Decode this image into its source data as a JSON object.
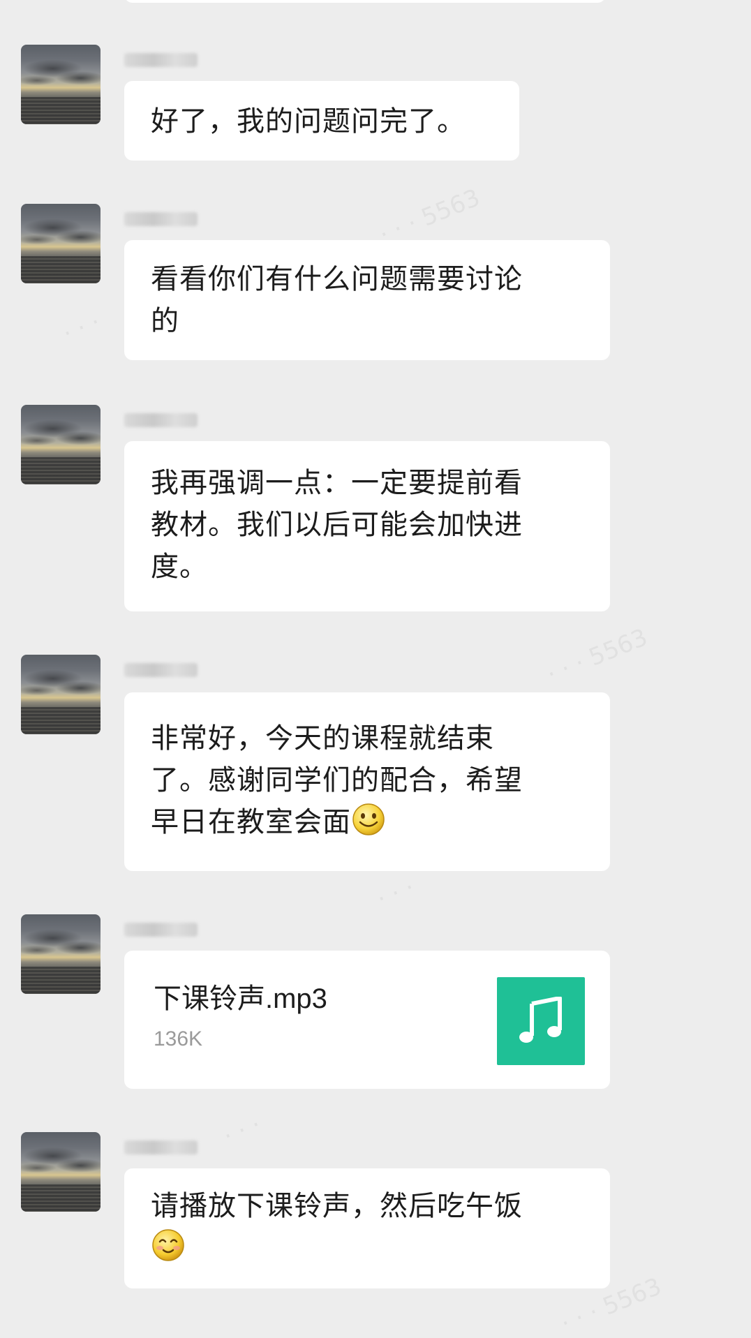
{
  "messages": [
    {
      "type": "text",
      "lines": "好了，我的问题问完了。",
      "emoji": ""
    },
    {
      "type": "text",
      "lines": "看看你们有什么问题需要讨论\n的",
      "emoji": ""
    },
    {
      "type": "text",
      "lines": "我再强调一点：一定要提前看\n教材。我们以后可能会加快进\n度。",
      "emoji": ""
    },
    {
      "type": "text",
      "lines": "非常好，今天的课程就结束\n了。感谢同学们的配合，希望\n早日在教室会面",
      "emoji": "smile-emoji"
    },
    {
      "type": "file",
      "file_name": "下课铃声.mp3",
      "file_size": "136K",
      "icon": "music-note-icon",
      "icon_color": "#1fc096"
    },
    {
      "type": "text",
      "lines": "请播放下课铃声，然后吃午饭\n",
      "emoji": "blush-emoji"
    }
  ],
  "colors": {
    "background": "#ededed",
    "bubble": "#ffffff",
    "text": "#1c1c1c",
    "file_size_text": "#9a9a9a",
    "file_icon_bg": "#1fc096"
  }
}
